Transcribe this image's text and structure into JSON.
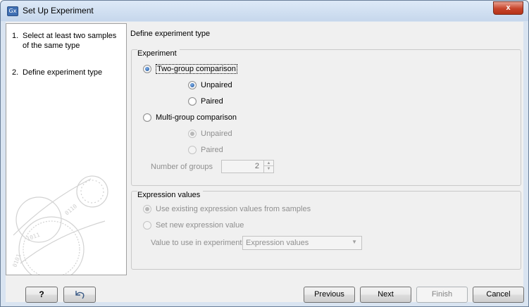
{
  "window": {
    "title": "Set Up Experiment",
    "app_icon_label": "Gx",
    "close_label": "x"
  },
  "steps": [
    {
      "num": "1.",
      "label": "Select at least two samples of the same type"
    },
    {
      "num": "2.",
      "label": "Define experiment type"
    }
  ],
  "main": {
    "title": "Define experiment type",
    "experiment": {
      "legend": "Experiment",
      "two_group": "Two-group comparison",
      "two_group_unpaired": "Unpaired",
      "two_group_paired": "Paired",
      "multi_group": "Multi-group comparison",
      "multi_group_unpaired": "Unpaired",
      "multi_group_paired": "Paired",
      "num_groups_label": "Number of groups",
      "num_groups_value": "2"
    },
    "expression": {
      "legend": "Expression values",
      "use_existing": "Use existing expression values from samples",
      "set_new": "Set new expression value",
      "value_label": "Value to use in experiment",
      "value_selected": "Expression values"
    }
  },
  "buttons": {
    "help": "?",
    "previous": "Previous",
    "next": "Next",
    "finish": "Finish",
    "cancel": "Cancel"
  },
  "icons": {
    "app": "gx-app-icon",
    "close": "close-icon",
    "reset": "undo-arrow-icon",
    "watermark": "dna-circles-watermark-icon"
  }
}
